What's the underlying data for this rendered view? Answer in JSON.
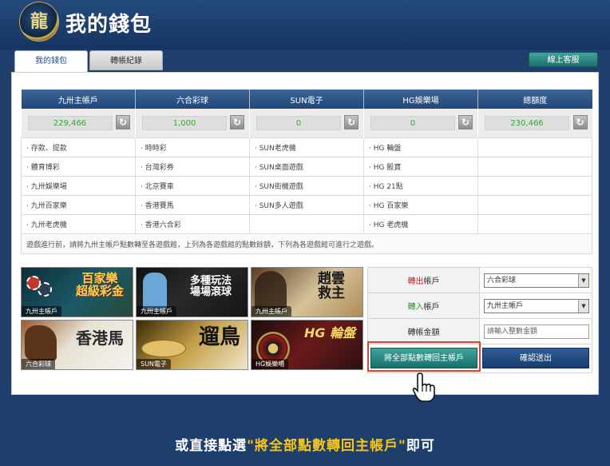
{
  "header": {
    "title": "我的錢包",
    "logo_icon": "dragon-emblem-icon"
  },
  "tabs": [
    {
      "label": "我的錢包",
      "active": true
    },
    {
      "label": "轉帳紀錄",
      "active": false
    }
  ],
  "support_button": "線上客服",
  "wallet": {
    "columns": [
      {
        "header": "九卅主帳戶",
        "balance": "229,466",
        "items": [
          "· 存款、提款",
          "· 體育博彩",
          "· 九卅娛樂場",
          "· 九卅百家樂",
          "· 九卅老虎機"
        ]
      },
      {
        "header": "六合彩球",
        "balance": "1,000",
        "items": [
          "· 時時彩",
          "· 台灣彩券",
          "· 北京賽車",
          "· 香港賽馬",
          "· 香港六合彩"
        ]
      },
      {
        "header": "SUN電子",
        "balance": "0",
        "items": [
          "· SUN老虎機",
          "· SUN桌面遊戲",
          "· SUN街機遊戲",
          "· SUN多人遊戲",
          ""
        ]
      },
      {
        "header": "HG娛樂場",
        "balance": "0",
        "items": [
          "· HG 輪盤",
          "· HG 骰寶",
          "· HG 21點",
          "· HG 百家樂",
          "· HG 老虎機"
        ]
      },
      {
        "header": "總額度",
        "balance": "230,466",
        "items": [
          "",
          "",
          "",
          "",
          ""
        ]
      }
    ],
    "note": "遊戲進行前，請將九卅主帳戶點數轉至各遊戲館，上列為各遊戲館的點數餘額，下列為各遊戲館可進行之遊戲。",
    "refresh_icon": "refresh-icon"
  },
  "banners": [
    {
      "title": "百家樂\n超級彩金",
      "caption": "九卅主帳戶"
    },
    {
      "title": "多種玩法\n場場滾球",
      "caption": "九卅主帳戶"
    },
    {
      "title": "趙雲\n救主",
      "caption": "九卅主帳戶"
    },
    {
      "title": "香港馬",
      "caption": "六合彩球"
    },
    {
      "title": "遛鳥",
      "caption": "SUN電子"
    },
    {
      "title": "HG 輪盤",
      "caption": "HG娛樂場"
    }
  ],
  "transfer": {
    "from_label_red": "轉出",
    "from_label_rest": "帳戶",
    "from_value": "六合彩球",
    "to_label_green": "轉入",
    "to_label_rest": "帳戶",
    "to_value": "九卅主帳戶",
    "amount_label": "轉帳金額",
    "amount_placeholder": "請輸入整數金額",
    "transfer_all_button": "將全部點數轉回主帳戶",
    "confirm_button": "確認送出"
  },
  "bottom_caption": {
    "before": "或直接點選",
    "highlight": "\"將全部點數轉回主帳戶\"",
    "after": "即可"
  },
  "colors": {
    "header_bg": "#1e3f6c",
    "accent_teal": "#18706a",
    "highlight_yellow": "#f5c518",
    "outline_red": "#e2412b"
  }
}
